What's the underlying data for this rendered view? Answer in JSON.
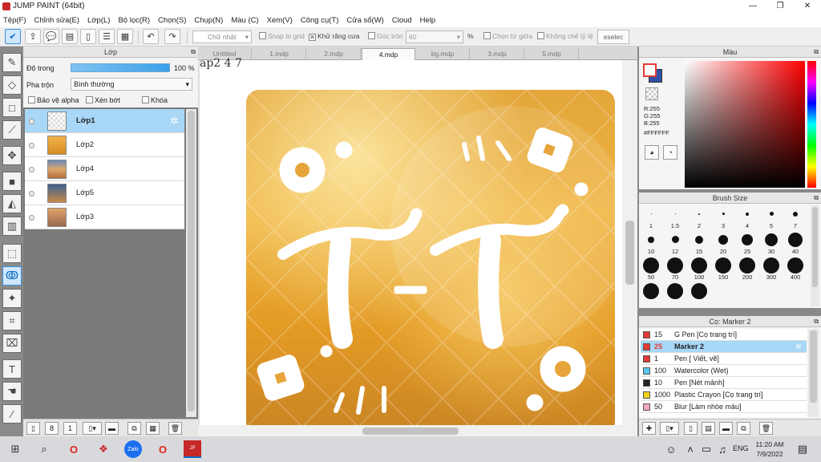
{
  "window": {
    "title": "JUMP PAINT (64bit)"
  },
  "menu": [
    "Tệp(F)",
    "Chỉnh sửa(E)",
    "Lớp(L)",
    "Bộ lọc(R)",
    "Chọn(S)",
    "Chụp(N)",
    "Màu (C)",
    "Xem(V)",
    "Công cụ(T)",
    "Cửa sổ(W)",
    "Cloud",
    "Help"
  ],
  "toolbar": {
    "shape_select": "Chữ nhật",
    "snap_to_grid": "Snap to grid",
    "antialias": "Khử răng cưa",
    "corner_round": "Góc tròn",
    "corner_value": "60",
    "percent": "%",
    "select_from_center": "Chọn từ giữa",
    "no_ratio_limit": "Không chế tỷ lệ",
    "deselect": "eselec"
  },
  "layer_panel": {
    "title": "Lớp",
    "opacity_label": "Độ trong",
    "opacity_value": "100 %",
    "opacity_level": 1.0,
    "blend_label": "Pha trộn",
    "blend_value": "Bình thường",
    "protect_alpha": "Bảo vệ alpha",
    "clip": "Xén bớt",
    "lock": "Khóa",
    "layers": [
      {
        "name": "Lớp1",
        "selected": true
      },
      {
        "name": "Lớp2",
        "selected": false
      },
      {
        "name": "Lớp4",
        "selected": false
      },
      {
        "name": "Lớp5",
        "selected": false
      },
      {
        "name": "Lớp3",
        "selected": false
      }
    ]
  },
  "tabs": [
    "Untitled",
    "1.mdp",
    "2.mdp",
    "4.mdp",
    "bg.mdp",
    "3.mdp",
    "5.mdp"
  ],
  "active_tab": "4.mdp",
  "canvas": {
    "corner_text": "ap2 4 7"
  },
  "color_panel": {
    "title": "Màu",
    "r": "R:255",
    "g": "G:255",
    "b": "B:255",
    "hex": "#FFFFFF",
    "fg_color": "#ffffff",
    "bg_color": "#2f4fa8"
  },
  "brush_size": {
    "title": "Brush Size",
    "sizes": [
      "1",
      "1.5",
      "2",
      "3",
      "4",
      "5",
      "7",
      "10",
      "12",
      "15",
      "20",
      "25",
      "30",
      "40",
      "50",
      "70",
      "100",
      "150",
      "200",
      "300",
      "400",
      "",
      "",
      ""
    ]
  },
  "brush_list": {
    "title": "Cọ: Marker 2",
    "items": [
      {
        "size": "15",
        "name": "G Pen [Cọ trang trí]",
        "color": "#e53935",
        "selected": false
      },
      {
        "size": "25",
        "name": "Marker 2",
        "color": "#e53935",
        "selected": true
      },
      {
        "size": "1",
        "name": "Pen [ Viết, vẽ]",
        "color": "#e53935",
        "selected": false
      },
      {
        "size": "100",
        "name": "Watercolor (Wet)",
        "color": "#5bc8f0",
        "selected": false
      },
      {
        "size": "10",
        "name": "Pen [Nét mảnh]",
        "color": "#222222",
        "selected": false
      },
      {
        "size": "1000",
        "name": "Plastic Crayon [Cọ trang trí]",
        "color": "#f2d21b",
        "selected": false
      },
      {
        "size": "50",
        "name": "Blur [Làm nhòe màu]",
        "color": "#f5a5c8",
        "selected": false
      }
    ]
  },
  "taskbar": {
    "time": "11:20 AM",
    "date": "7/9/2022",
    "lang": "ENG"
  }
}
